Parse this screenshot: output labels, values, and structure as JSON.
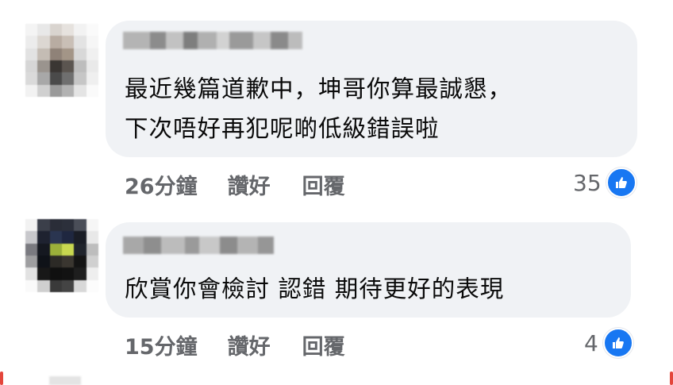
{
  "comments": [
    {
      "text_lines": [
        "最近幾篇道歉中，坤哥你算最誠懇，",
        "下次唔好再犯呢啲低級錯誤啦"
      ],
      "time": "26分鐘",
      "like_label": "讚好",
      "reply_label": "回覆",
      "reaction_count": "35",
      "reaction_icon": "like-icon"
    },
    {
      "text_lines": [
        "欣賞你會檢討 認錯 期待更好的表現"
      ],
      "time": "15分鐘",
      "like_label": "讚好",
      "reply_label": "回覆",
      "reaction_count": "4",
      "reaction_icon": "like-icon"
    }
  ],
  "colors": {
    "bubble": "#f0f2f5",
    "meta_text": "#65676b",
    "like_blue": "#1877f2"
  }
}
